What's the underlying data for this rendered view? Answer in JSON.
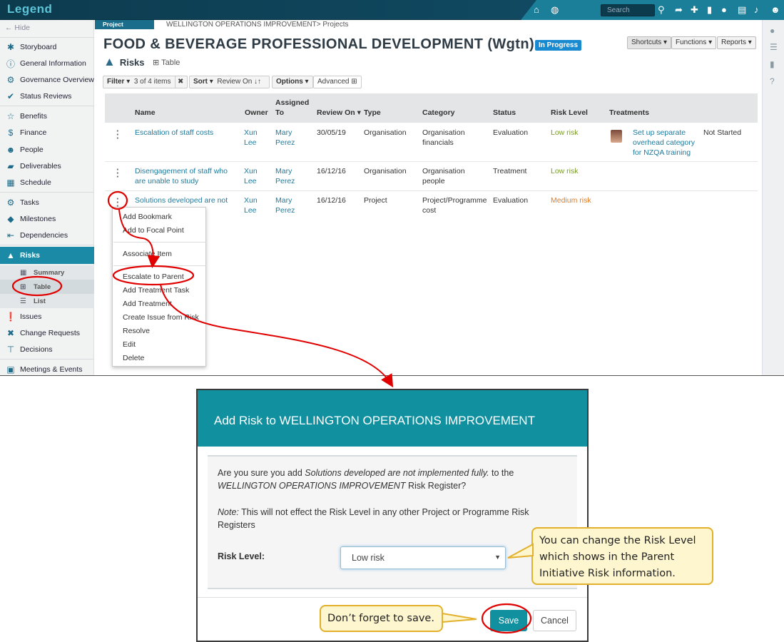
{
  "app": {
    "logo": "Legend"
  },
  "topbar": {
    "search_placeholder": "Search"
  },
  "sidebar": {
    "hide_label": "← Hide",
    "items": [
      {
        "label": "Storyboard"
      },
      {
        "label": "General Information"
      },
      {
        "label": "Governance Overview"
      },
      {
        "label": "Status Reviews"
      },
      {
        "label": "Benefits"
      },
      {
        "label": "Finance"
      },
      {
        "label": "People"
      },
      {
        "label": "Deliverables"
      },
      {
        "label": "Schedule"
      },
      {
        "label": "Tasks"
      },
      {
        "label": "Milestones"
      },
      {
        "label": "Dependencies"
      },
      {
        "label": "Risks"
      },
      {
        "label": "Issues"
      },
      {
        "label": "Change Requests"
      },
      {
        "label": "Decisions"
      },
      {
        "label": "Meetings & Events"
      }
    ],
    "risk_sub": [
      {
        "label": "Summary"
      },
      {
        "label": "Table"
      },
      {
        "label": "List"
      }
    ]
  },
  "header": {
    "badge": "Project",
    "breadcrumb": "WELLINGTON OPERATIONS IMPROVEMENT> Projects",
    "title": "FOOD & BEVERAGE PROFESSIONAL DEVELOPMENT (Wgtn)",
    "status": "In Progress",
    "shortcuts": "Shortcuts ▾",
    "functions": "Functions ▾",
    "reports": "Reports ▾",
    "section": "Risks",
    "view": "Table"
  },
  "toolbar": {
    "filter": "Filter ▾",
    "filter_count": "3 of 4 items",
    "clear": "✖",
    "sort": "Sort ▾",
    "sort_value": "Review On ↓↑",
    "options": "Options ▾",
    "advanced": "Advanced"
  },
  "table": {
    "headers": {
      "name": "Name",
      "owner": "Owner",
      "assigned_1": "Assigned",
      "assigned_2": "To",
      "review_on": "Review On ▾",
      "type": "Type",
      "category": "Category",
      "status": "Status",
      "risk_level": "Risk Level",
      "treatments": "Treatments"
    },
    "rows": [
      {
        "name_1": "Escalation of staff costs",
        "name_2": "",
        "owner_1": "Xun",
        "owner_2": "Lee",
        "assigned_1": "Mary",
        "assigned_2": "Perez",
        "review_on": "30/05/19",
        "type": "Organisation",
        "category_1": "Organisation",
        "category_2": "financials",
        "status": "Evaluation",
        "risk_level": "Low risk",
        "treatment_1": "Set up separate",
        "treatment_2": "overhead category",
        "treatment_3": "for NZQA training",
        "treatment_status": "Not Started"
      },
      {
        "name_1": "Disengagement of staff who",
        "name_2": "are unable to study",
        "owner_1": "Xun",
        "owner_2": "Lee",
        "assigned_1": "Mary",
        "assigned_2": "Perez",
        "review_on": "16/12/16",
        "type": "Organisation",
        "category_1": "Organisation",
        "category_2": "people",
        "status": "Treatment",
        "risk_level": "Low risk"
      },
      {
        "name_1": "Solutions developed are not",
        "name_2": "",
        "owner_1": "Xun",
        "owner_2": "Lee",
        "assigned_1": "Mary",
        "assigned_2": "Perez",
        "review_on": "16/12/16",
        "type": "Project",
        "category_1": "Project/Programme",
        "category_2": "cost",
        "status": "Evaluation",
        "risk_level": "Medium risk"
      }
    ]
  },
  "context_menu": {
    "items": [
      "Add Bookmark",
      "Add to Focal Point",
      "Associate Item",
      "Escalate to Parent",
      "Add Treatment Task",
      "Add Treatment",
      "Create Issue from Risk",
      "Resolve",
      "Edit",
      "Delete"
    ]
  },
  "dialog": {
    "title": "Add Risk to WELLINGTON OPERATIONS IMPROVEMENT",
    "q_prefix": "Are you sure you add ",
    "q_risk": "Solutions developed are not implemented fully.",
    "q_mid": " to the",
    "q_parent": "WELLINGTON OPERATIONS IMPROVEMENT",
    "q_suffix": " Risk Register?",
    "note_label": "Note:",
    "note_text": " This will not effect the Risk Level in any other Project or Programme Risk Registers",
    "risk_level_label": "Risk Level:",
    "risk_level_value": "Low risk",
    "save": "Save",
    "cancel": "Cancel"
  },
  "callouts": {
    "risk_level_1": "You can change the Risk Level",
    "risk_level_2": "which shows in the Parent",
    "risk_level_3": "Initiative Risk information.",
    "save": "Don’t forget to save."
  },
  "colors": {
    "accent": "#11909f",
    "annotation": "#e00000",
    "callout_bg": "#fef6cf",
    "callout_border": "#e3b02b"
  }
}
